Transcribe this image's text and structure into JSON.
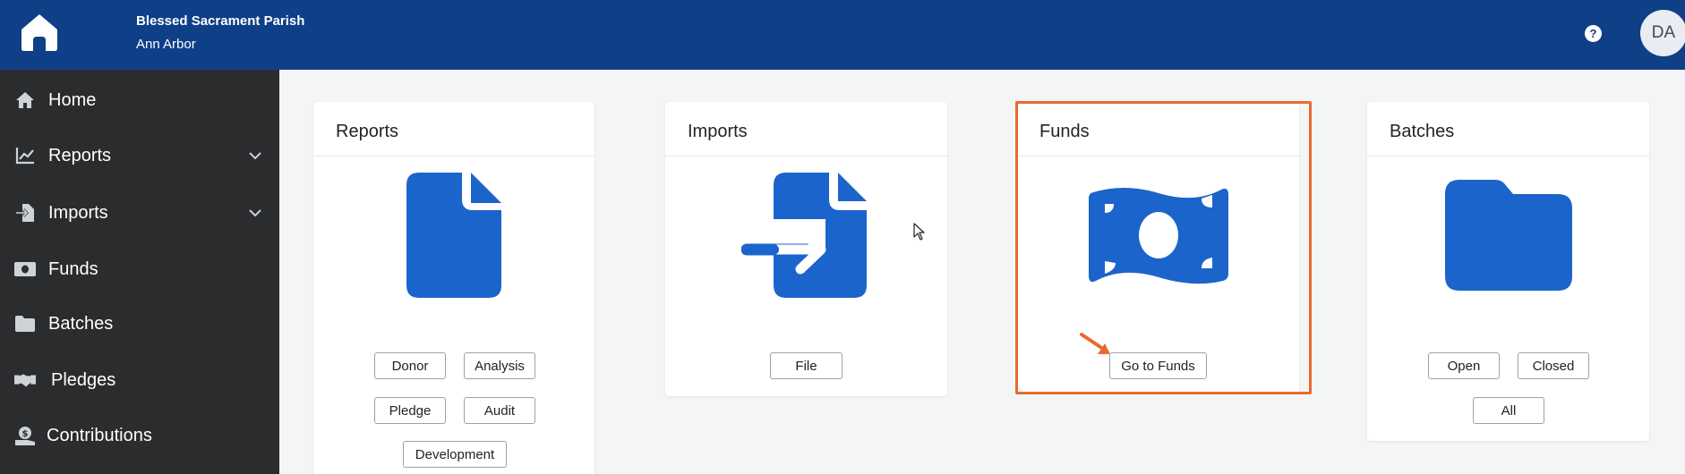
{
  "header": {
    "parish_name": "Blessed Sacrament Parish",
    "parish_city": "Ann Arbor",
    "help_label": "?",
    "avatar_initials": "DA"
  },
  "sidebar": {
    "items": [
      {
        "label": "Home",
        "icon": "home-icon"
      },
      {
        "label": "Reports",
        "icon": "chart-line-icon"
      },
      {
        "label": "Imports",
        "icon": "file-import-icon"
      },
      {
        "label": "Funds",
        "icon": "money-bill-icon"
      },
      {
        "label": "Batches",
        "icon": "folder-icon"
      },
      {
        "label": "Pledges",
        "icon": "handshake-icon"
      },
      {
        "label": "Contributions",
        "icon": "hand-holding-dollar-icon"
      }
    ]
  },
  "cards": {
    "reports": {
      "title": "Reports",
      "icon": "file-icon",
      "buttons": [
        "Donor",
        "Analysis",
        "Pledge",
        "Audit",
        "Development"
      ]
    },
    "imports": {
      "title": "Imports",
      "icon": "file-import-icon",
      "buttons": [
        "File"
      ]
    },
    "funds": {
      "title": "Funds",
      "icon": "money-bill-icon",
      "buttons": [
        "Go to Funds"
      ]
    },
    "batches": {
      "title": "Batches",
      "icon": "folder-icon",
      "buttons": [
        "Open",
        "Closed",
        "All"
      ]
    }
  },
  "colors": {
    "header_bg": "#0e3f87",
    "sidebar_bg": "#2a2c2e",
    "icon_blue": "#1b64cc",
    "highlight": "#ea6a2e"
  }
}
